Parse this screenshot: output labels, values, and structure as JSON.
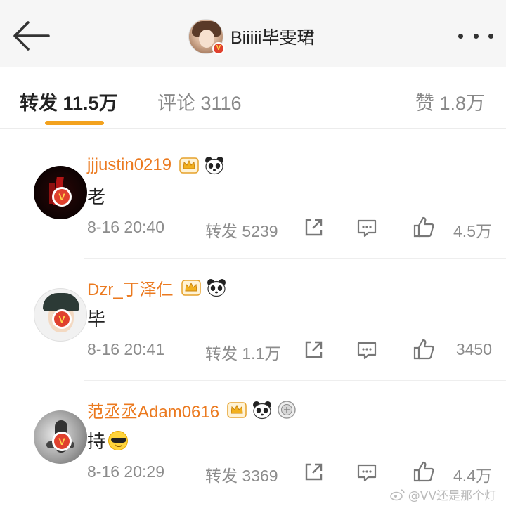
{
  "header": {
    "title": "Biiiii毕雯珺",
    "verified_badge": "V"
  },
  "tabs": {
    "repost": "转发 11.5万",
    "comment": "评论 3116",
    "like": "赞 1.8万",
    "active": "repost",
    "accent_color": "#f3a21e"
  },
  "reposts": [
    {
      "username": "jjjustin0219",
      "comment": "老",
      "time": "8-16 20:40",
      "reposts": "转发 5239",
      "likes": "4.5万",
      "badges": [
        "crown-icon",
        "panda-icon"
      ]
    },
    {
      "username": "Dzr_丁泽仁",
      "comment": "毕",
      "time": "8-16 20:41",
      "reposts": "转发 1.1万",
      "likes": "3450",
      "badges": [
        "crown-icon",
        "panda-icon"
      ]
    },
    {
      "username": "范丞丞Adam0616",
      "comment": "持",
      "time": "8-16 20:29",
      "reposts": "转发 3369",
      "likes": "4.4万",
      "badges": [
        "crown-icon",
        "panda-icon",
        "medal-icon"
      ]
    }
  ],
  "watermark": "@VV还是那个灯",
  "colors": {
    "username": "#eb7a20",
    "verified": "#e0412e",
    "meta_text": "#8c8c8c"
  }
}
